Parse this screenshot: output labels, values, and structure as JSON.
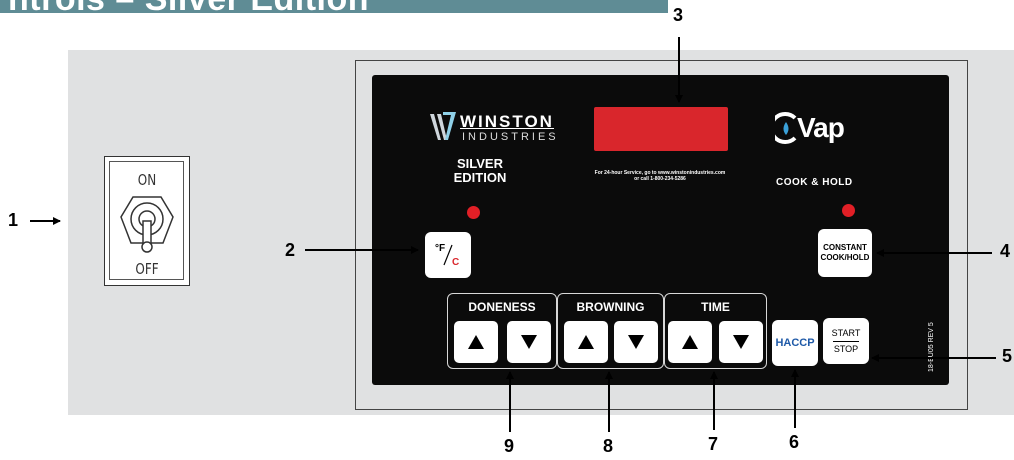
{
  "header": {
    "title": "ntrols – Silver Edition"
  },
  "callouts": {
    "c1": "1",
    "c2": "2",
    "c3": "3",
    "c4": "4",
    "c5": "5",
    "c6": "6",
    "c7": "7",
    "c8": "8",
    "c9": "9"
  },
  "switch": {
    "on_label": "ON",
    "off_label": "OFF"
  },
  "brand": {
    "name": "WINSTON",
    "sub": "INDUSTRIES",
    "edition_line1": "SILVER",
    "edition_line2": "EDITION"
  },
  "service": {
    "line1": "For 24-hour Service, go to www.winstonindustries.com",
    "line2": "or call 1-800-234-5286"
  },
  "cvap": {
    "logo": "CVap",
    "mode": "COOK & HOLD"
  },
  "buttons": {
    "temp_unit_f": "°F",
    "temp_unit_c": "C",
    "constant_line1": "CONSTANT",
    "constant_line2": "COOK/HOLD",
    "haccp": "HACCP",
    "start": "START",
    "stop": "STOP"
  },
  "groups": {
    "doneness": "DONENESS",
    "browning": "BROWNING",
    "time": "TIME"
  },
  "part_number": "18-BU05 REV 5",
  "colors": {
    "header": "#5f8c95",
    "display": "#d9262c",
    "led": "#e11f26",
    "haccp_text": "#1f5aa8",
    "panel": "#0b0b0b"
  }
}
